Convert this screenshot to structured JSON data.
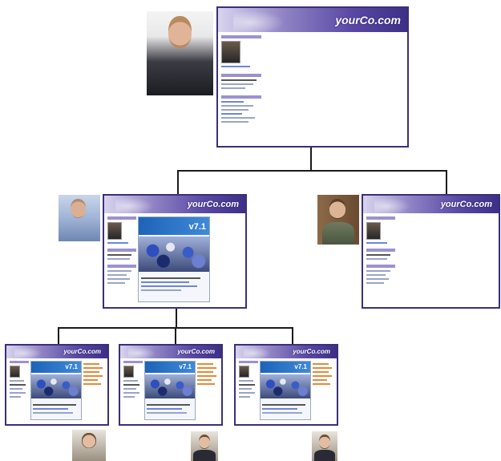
{
  "brand": "yourCo.com",
  "version_label": "v7.1",
  "colors": {
    "frame": "#3b2f78",
    "banner_dark": "#3d2f86",
    "banner_light": "#d9d4ee",
    "connector": "#1a1a1a"
  },
  "nodes": {
    "root": {
      "brand": "yourCo.com"
    },
    "left_child": {
      "brand": "yourCo.com"
    },
    "right_child": {
      "brand": "yourCo.com"
    },
    "leaves": [
      {
        "brand": "yourCo.com"
      },
      {
        "brand": "yourCo.com"
      },
      {
        "brand": "yourCo.com"
      }
    ]
  }
}
